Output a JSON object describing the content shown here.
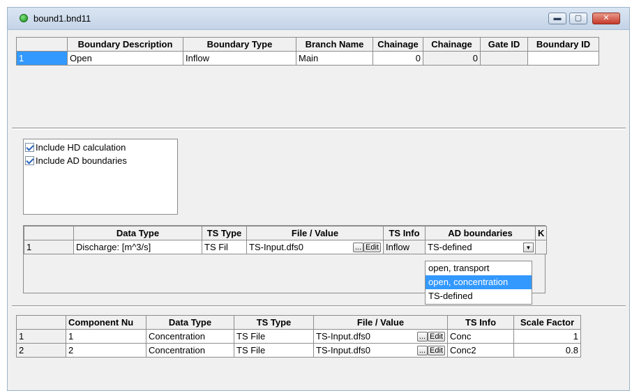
{
  "window": {
    "title": "bound1.bnd11",
    "min": "▬",
    "max": "▢",
    "close": "✕"
  },
  "boundary": {
    "headers": [
      "Boundary Description",
      "Boundary Type",
      "Branch Name",
      "Chainage",
      "Chainage",
      "Gate ID",
      "Boundary ID"
    ],
    "row": {
      "index": "1",
      "description": "Open",
      "type": "Inflow",
      "branch": "Main",
      "chainage1": "0",
      "chainage2": "0",
      "gate_id": "",
      "boundary_id": ""
    }
  },
  "options": {
    "include_hd": "Include HD calculation",
    "include_ad": "Include AD boundaries"
  },
  "ts_table": {
    "headers": [
      "Data Type",
      "TS Type",
      "File / Value",
      "TS Info",
      "AD boundaries",
      "K"
    ],
    "row": {
      "index": "1",
      "data_type": "Discharge: [m^3/s]",
      "ts_type": "TS Fil",
      "file": "TS-Input.dfs0",
      "browse": "...",
      "edit": "Edit",
      "ts_info": "Inflow",
      "ad": "TS-defined"
    },
    "dropdown": [
      "open, transport",
      "open, concentration",
      "TS-defined"
    ]
  },
  "components": {
    "headers": [
      "Component Nu",
      "Data Type",
      "TS Type",
      "File / Value",
      "TS Info",
      "Scale Factor"
    ],
    "rows": [
      {
        "index": "1",
        "num": "1",
        "data_type": "Concentration",
        "ts_type": "TS File",
        "file": "TS-Input.dfs0",
        "browse": "...",
        "edit": "Edit",
        "ts_info": "Conc",
        "scale": "1"
      },
      {
        "index": "2",
        "num": "2",
        "data_type": "Concentration",
        "ts_type": "TS File",
        "file": "TS-Input.dfs0",
        "browse": "...",
        "edit": "Edit",
        "ts_info": "Conc2",
        "scale": "0.8"
      }
    ]
  }
}
